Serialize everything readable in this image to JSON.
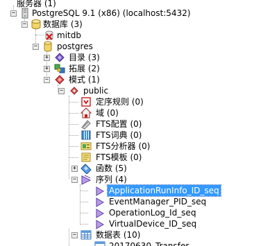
{
  "tree": {
    "servers_label": "服务器 (1)",
    "server_label": "PostgreSQL 9.1 (x86) (localhost:5432)",
    "databases_label": "数据库 (3)",
    "db_mitdb": "mitdb",
    "db_postgres": "postgres",
    "catalogs_label": "目录 (3)",
    "extensions_label": "拓展 (2)",
    "schemas_label": "模式 (1)",
    "schema_public": "public",
    "rules_label": "定序规则 (0)",
    "domains_label": "域 (0)",
    "fts_config_label": "FTS配置 (0)",
    "fts_dict_label": "FTS词典 (0)",
    "fts_parser_label": "FTS分析器 (0)",
    "fts_template_label": "FTS模板 (0)",
    "functions_label": "函数 (5)",
    "sequences_label": "序列 (4)",
    "sequences": [
      "ApplicationRunInfo_ID_seq",
      "EventManager_PID_seq",
      "OperationLog_Id_seq",
      "VirtualDevice_ID_seq"
    ],
    "tables_label": "数据表 (10)",
    "table_partial": "20170630_Transfer"
  },
  "colors": {
    "selection": "#3399ff",
    "tree_lines": "#a0a0a0"
  }
}
